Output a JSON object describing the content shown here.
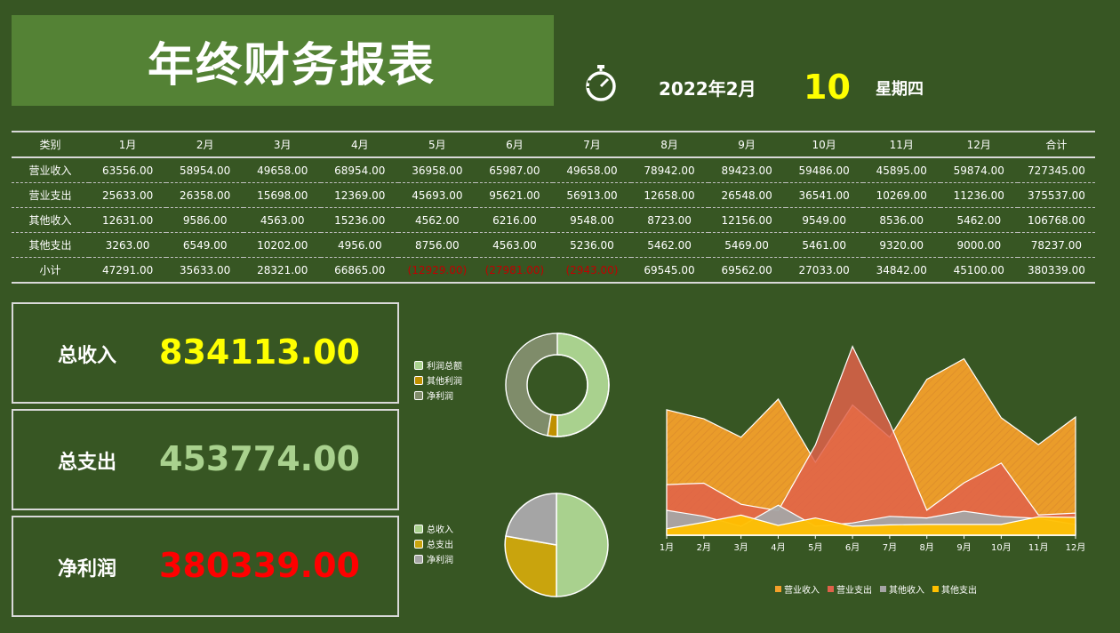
{
  "title": "年终财务报表",
  "date": {
    "year_month": "2022年2月",
    "day": "10",
    "weekday": "星期四",
    "icon": "stopwatch-icon"
  },
  "table": {
    "headers": [
      "类别",
      "1月",
      "2月",
      "3月",
      "4月",
      "5月",
      "6月",
      "7月",
      "8月",
      "9月",
      "10月",
      "11月",
      "12月",
      "合计"
    ],
    "rows": [
      [
        "营业收入",
        "63556.00",
        "58954.00",
        "49658.00",
        "68954.00",
        "36958.00",
        "65987.00",
        "49658.00",
        "78942.00",
        "89423.00",
        "59486.00",
        "45895.00",
        "59874.00",
        "727345.00"
      ],
      [
        "营业支出",
        "25633.00",
        "26358.00",
        "15698.00",
        "12369.00",
        "45693.00",
        "95621.00",
        "56913.00",
        "12658.00",
        "26548.00",
        "36541.00",
        "10269.00",
        "11236.00",
        "375537.00"
      ],
      [
        "其他收入",
        "12631.00",
        "9586.00",
        "4563.00",
        "15236.00",
        "4562.00",
        "6216.00",
        "9548.00",
        "8723.00",
        "12156.00",
        "9549.00",
        "8536.00",
        "5462.00",
        "106768.00"
      ],
      [
        "其他支出",
        "3263.00",
        "6549.00",
        "10202.00",
        "4956.00",
        "8756.00",
        "4563.00",
        "5236.00",
        "5462.00",
        "5469.00",
        "5461.00",
        "9320.00",
        "9000.00",
        "78237.00"
      ],
      [
        "小计",
        "47291.00",
        "35633.00",
        "28321.00",
        "66865.00",
        "(12929.00)",
        "(27981.00)",
        "(2943.00)",
        "69545.00",
        "69562.00",
        "27033.00",
        "34842.00",
        "45100.00",
        "380339.00"
      ]
    ],
    "negative_color": "#c00000"
  },
  "cards": {
    "income": {
      "label": "总收入",
      "value": "834113.00",
      "color": "#ffff00"
    },
    "expense": {
      "label": "总支出",
      "value": "453774.00",
      "color": "#a9d18e"
    },
    "profit": {
      "label": "净利润",
      "value": "380339.00",
      "color": "#ff0000"
    }
  },
  "donut": {
    "legend": [
      "利润总额",
      "其他利润",
      "净利润"
    ],
    "colors": [
      "#a9d18e",
      "#bf9000",
      "#7f8c6a"
    ]
  },
  "pie": {
    "legend": [
      "总收入",
      "总支出",
      "净利润"
    ],
    "colors": [
      "#a9d18e",
      "#c9a40d",
      "#a5a5a5"
    ]
  },
  "chart_data": {
    "type": "area",
    "categories": [
      "1月",
      "2月",
      "3月",
      "4月",
      "5月",
      "6月",
      "7月",
      "8月",
      "9月",
      "10月",
      "11月",
      "12月"
    ],
    "series": [
      {
        "name": "营业收入",
        "color": "#f4a02a",
        "values": [
          63556,
          58954,
          49658,
          68954,
          36958,
          65987,
          49658,
          78942,
          89423,
          59486,
          45895,
          59874
        ]
      },
      {
        "name": "营业支出",
        "color": "#e0614a",
        "values": [
          25633,
          26358,
          15698,
          12369,
          45693,
          95621,
          56913,
          12658,
          26548,
          36541,
          10269,
          11236
        ]
      },
      {
        "name": "其他收入",
        "color": "#a5a5a5",
        "values": [
          12631,
          9586,
          4563,
          15236,
          4562,
          6216,
          9548,
          8723,
          12156,
          9549,
          8536,
          5462
        ]
      },
      {
        "name": "其他支出",
        "color": "#ffc000",
        "values": [
          3263,
          6549,
          10202,
          4956,
          8756,
          4563,
          5236,
          5462,
          5469,
          5461,
          9320,
          9000
        ]
      }
    ],
    "ylim": [
      0,
      100000
    ],
    "legend_position": "bottom"
  }
}
